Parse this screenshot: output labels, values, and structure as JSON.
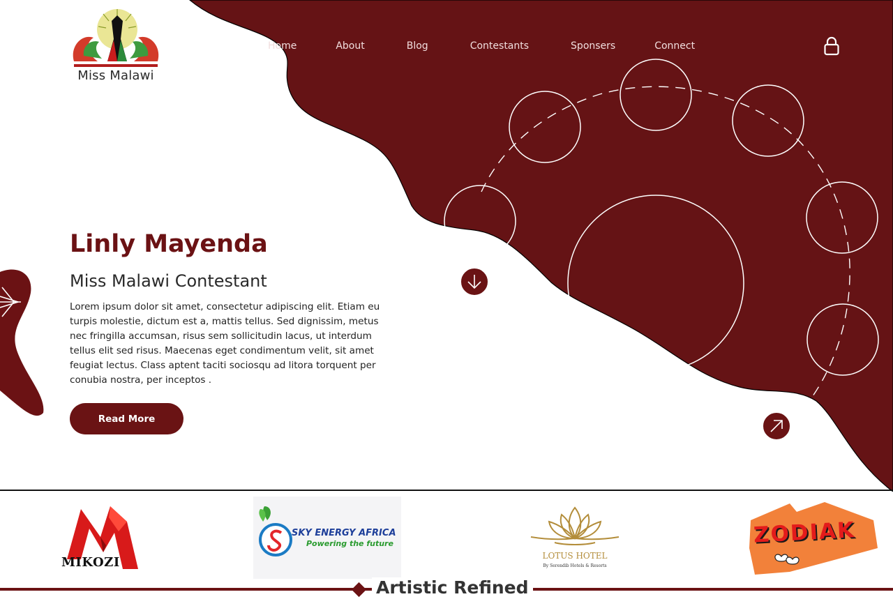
{
  "brand": {
    "name": "Miss Malawi"
  },
  "nav": {
    "items": [
      "Home",
      "About",
      "Blog",
      "Contestants",
      "Sponsers",
      "Connect"
    ]
  },
  "hero": {
    "name": "Linly Mayenda",
    "subtitle": "Miss Malawi Contestant",
    "description": "Lorem ipsum dolor sit amet, consectetur adipiscing elit. Etiam eu turpis molestie, dictum est a, mattis tellus. Sed dignissim, metus nec fringilla accumsan, risus sem sollicitudin lacus, ut interdum tellus elit sed risus. Maecenas eget condimentum velit, sit amet feugiat lectus. Class aptent taciti sociosqu ad litora torquent per conubia nostra, per inceptos .",
    "button_label": "Read More"
  },
  "sponsors": {
    "mikozi": "MIKOZI",
    "sky_energy": {
      "name": "SKY ENERGY AFRICA",
      "tagline": "Powering the future"
    },
    "lotus": {
      "name": "LOTUS HOTEL",
      "tagline": "By Serendib Hotels & Resorts"
    },
    "zodiak": "ZODIAK"
  },
  "section": {
    "title": "Artistic Refined"
  },
  "colors": {
    "brand": "#6b1214",
    "text": "#2a2a2a",
    "nav_text": "#f1dede"
  },
  "icons": {
    "lock": "lock-icon",
    "down": "arrow-down-icon",
    "next": "arrow-up-right-icon"
  }
}
